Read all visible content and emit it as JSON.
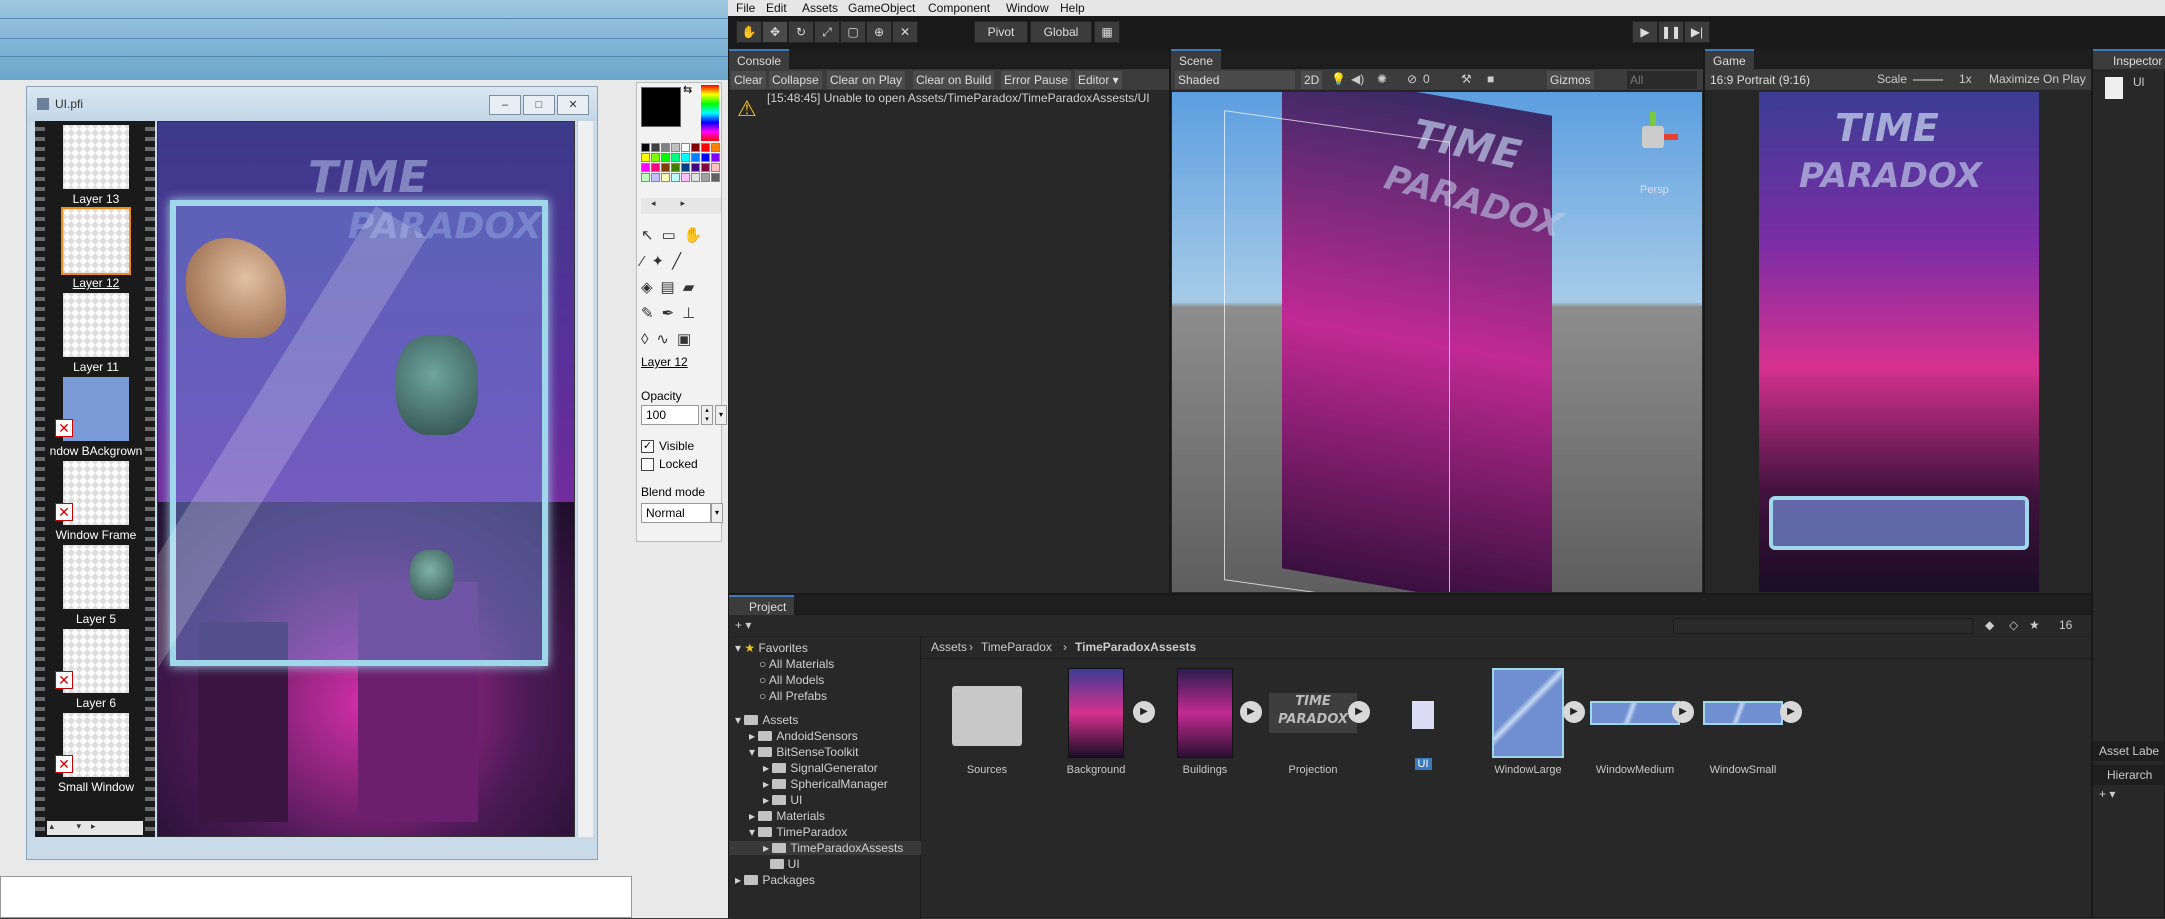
{
  "paint": {
    "window_title": "UI.pfi",
    "layers": [
      {
        "label": "Layer 13",
        "hidden": false
      },
      {
        "label": "Layer 12",
        "hidden": false,
        "selected": true
      },
      {
        "label": "Layer 11",
        "hidden": false
      },
      {
        "label": "ndow BAckgrown",
        "hidden": true
      },
      {
        "label": "Window Frame",
        "hidden": true
      },
      {
        "label": "Layer 5",
        "hidden": false
      },
      {
        "label": "Layer 6",
        "hidden": true
      },
      {
        "label": "Small Window",
        "hidden": true
      }
    ],
    "canvas_title": "TIME",
    "canvas_subtitle": "PARADOX",
    "panel": {
      "layer_name": "Layer 12",
      "opacity_label": "Opacity",
      "opacity_value": "100",
      "visible_label": "Visible",
      "visible_checked": true,
      "locked_label": "Locked",
      "locked_checked": false,
      "blend_label": "Blend mode",
      "blend_value": "Normal"
    },
    "palette": [
      "#000000",
      "#404040",
      "#808080",
      "#c0c0c0",
      "#ffffff",
      "#800000",
      "#ff0000",
      "#ff8000",
      "#ffff00",
      "#80ff00",
      "#00ff00",
      "#00ff80",
      "#00ffff",
      "#0080ff",
      "#0000ff",
      "#8000ff",
      "#ff00ff",
      "#ff0080",
      "#804000",
      "#408000",
      "#004080",
      "#400080",
      "#800040",
      "#ffc0c0",
      "#c0ffc0",
      "#c0c0ff",
      "#ffffc0",
      "#c0ffff",
      "#ffc0ff",
      "#e0e0e0",
      "#a0a0a0",
      "#606060"
    ]
  },
  "unity": {
    "menu": [
      "File",
      "Edit",
      "Assets",
      "GameObject",
      "Component",
      "Window",
      "Help"
    ],
    "pivot": "Pivot",
    "global": "Global",
    "console": {
      "tab": "Console",
      "buttons": [
        "Clear",
        "Collapse",
        "Clear on Play",
        "Clear on Build",
        "Error Pause",
        "Editor ▾"
      ],
      "message": "[15:48:45] Unable to open Assets/TimeParadox/TimeParadoxAssests/UI"
    },
    "scene": {
      "tab": "Scene",
      "shading": "Shaded",
      "mode2d": "2D",
      "hidden_count": "0",
      "gizmos": "Gizmos",
      "search": "All",
      "persp": "Persp",
      "sign_title": "TIME",
      "sign_subtitle": "PARADOX"
    },
    "game": {
      "tab": "Game",
      "aspect": "16:9 Portrait (9:16)",
      "scale_label": "Scale",
      "scale_value": "1x",
      "maximize": "Maximize On Play",
      "title": "TIME",
      "subtitle": "PARADOX"
    },
    "inspector": {
      "tab": "Inspector",
      "ul": "Ul"
    },
    "asset_labels": "Asset Labe",
    "hierarchy": "Hierarch",
    "project": {
      "tab": "Project",
      "count": "16",
      "breadcrumb": [
        "Assets",
        "TimeParadox",
        "TimeParadoxAssests"
      ],
      "favorites": "Favorites",
      "fav_items": [
        "All Materials",
        "All Models",
        "All Prefabs"
      ],
      "assets": "Assets",
      "tree": [
        {
          "label": "AndoidSensors",
          "depth": 1
        },
        {
          "label": "BitSenseToolkit",
          "depth": 1
        },
        {
          "label": "SignalGenerator",
          "depth": 2
        },
        {
          "label": "SphericalManager",
          "depth": 2
        },
        {
          "label": "UI",
          "depth": 2
        },
        {
          "label": "Materials",
          "depth": 1
        },
        {
          "label": "TimeParadox",
          "depth": 1
        },
        {
          "label": "TimeParadoxAssests",
          "depth": 2,
          "selected": true
        },
        {
          "label": "UI",
          "depth": 2
        }
      ],
      "packages": "Packages",
      "items": [
        "Sources",
        "Background",
        "Buildings",
        "Projection",
        "UI",
        "WindowLarge",
        "WindowMedium",
        "WindowSmall"
      ]
    }
  }
}
